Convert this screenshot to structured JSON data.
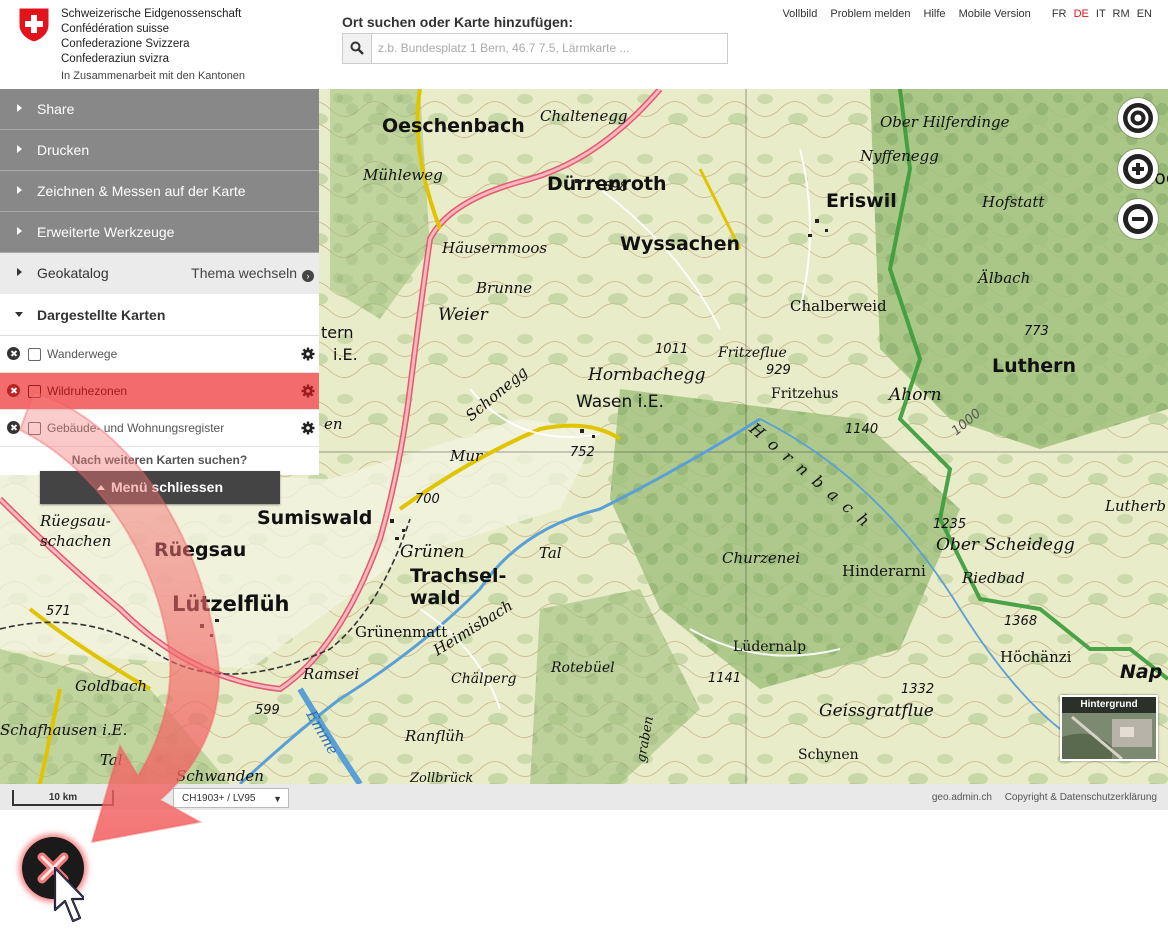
{
  "header": {
    "confederation_lines": [
      "Schweizerische Eidgenossenschaft",
      "Confédération suisse",
      "Confederazione Svizzera",
      "Confederaziun svizra"
    ],
    "cooperation": "In Zusammenarbeit mit den Kantonen",
    "search_title": "Ort suchen oder Karte hinzufügen:",
    "search_placeholder": "z.b. Bundesplatz 1 Bern, 46.7 7.5, Lärmkarte ...",
    "links": [
      "Vollbild",
      "Problem melden",
      "Hilfe",
      "Mobile Version"
    ],
    "languages": [
      "FR",
      "DE",
      "IT",
      "RM",
      "EN"
    ],
    "active_language": "DE",
    "accent_color": "#e3131b"
  },
  "menu": {
    "sections": [
      "Share",
      "Drucken",
      "Zeichnen & Messen auf der Karte",
      "Erweiterte Werkzeuge"
    ],
    "geokatalog": "Geokatalog",
    "thema_wechseln": "Thema wechseln",
    "dargestellte_karten": "Dargestellte Karten",
    "layers": [
      {
        "name": "Wanderwege",
        "highlighted": false
      },
      {
        "name": "Wildruhezonen",
        "highlighted": true
      },
      {
        "name": "Gebäude- und Wohnungsregister",
        "highlighted": false
      }
    ],
    "more_maps": "Nach weiteren Karten suchen?",
    "close_menu": "Menü schliessen",
    "highlight_color": "#f36c6c"
  },
  "map": {
    "labels": [
      {
        "text": "Oeschenbach",
        "cls": "big"
      },
      {
        "text": "Chaltenegg",
        "cls": "it"
      },
      {
        "text": "Mühleweg",
        "cls": "it"
      },
      {
        "text": "Dürrenroth",
        "cls": "big"
      },
      {
        "text": "698",
        "cls": "num"
      },
      {
        "text": "Wyssachen",
        "cls": "big"
      },
      {
        "text": "Häusernmoos",
        "cls": "it"
      },
      {
        "text": "Brunne",
        "cls": "it"
      },
      {
        "text": "Weier",
        "cls": "it"
      },
      {
        "text": "tern",
        "cls": "mid"
      },
      {
        "text": "i.E.",
        "cls": "mid"
      },
      {
        "text": "en",
        "cls": "it"
      },
      {
        "text": "1011",
        "cls": "num"
      },
      {
        "text": "Fritzeflue",
        "cls": "it"
      },
      {
        "text": "Hornbachegg",
        "cls": "it"
      },
      {
        "text": "929",
        "cls": "num"
      },
      {
        "text": "Fritzehus",
        "cls": "it"
      },
      {
        "text": "Wasen i.E.",
        "cls": "big"
      },
      {
        "text": "Schonegg",
        "cls": "it"
      },
      {
        "text": "Mur",
        "cls": "it"
      },
      {
        "text": "752",
        "cls": "num"
      },
      {
        "text": "700",
        "cls": "num"
      },
      {
        "text": "1140",
        "cls": "num"
      },
      {
        "text": "Ober Hilferdinge",
        "cls": "it"
      },
      {
        "text": "Nyffenegg",
        "cls": "it"
      },
      {
        "text": "Eriswil",
        "cls": "big"
      },
      {
        "text": "Hofstatt",
        "cls": "it"
      },
      {
        "text": "Älbach",
        "cls": "it"
      },
      {
        "text": "Chalberweid",
        "cls": "it"
      },
      {
        "text": "773",
        "cls": "num"
      },
      {
        "text": "Luthern",
        "cls": "big"
      },
      {
        "text": "Ahorn",
        "cls": "it"
      },
      {
        "text": "1000",
        "cls": "num"
      },
      {
        "text": "Hornbach",
        "cls": "it"
      },
      {
        "text": "Lutherb",
        "cls": "it"
      },
      {
        "text": "1235",
        "cls": "num"
      },
      {
        "text": "Ober Scheidegg",
        "cls": "it"
      },
      {
        "text": "Riedbad",
        "cls": "it"
      },
      {
        "text": "Hinderarni",
        "cls": "it"
      },
      {
        "text": "Churzenei",
        "cls": "it"
      },
      {
        "text": "1368",
        "cls": "num"
      },
      {
        "text": "Höchänzi",
        "cls": "it"
      },
      {
        "text": "Nap",
        "cls": "big"
      },
      {
        "text": "Rüegsau-",
        "cls": "it"
      },
      {
        "text": "schachen",
        "cls": "it"
      },
      {
        "text": "Rüegsau",
        "cls": "big"
      },
      {
        "text": "Sumiswald",
        "cls": "big"
      },
      {
        "text": "Grünen",
        "cls": "it"
      },
      {
        "text": "Trachsel-",
        "cls": "big"
      },
      {
        "text": "wald",
        "cls": "big"
      },
      {
        "text": "Tal",
        "cls": "it"
      },
      {
        "text": "571",
        "cls": "num"
      },
      {
        "text": "Lützelflüh",
        "cls": "big"
      },
      {
        "text": "Grünenmatt",
        "cls": "it"
      },
      {
        "text": "Heimisbach",
        "cls": "it"
      },
      {
        "text": "Lüdernalp",
        "cls": "it"
      },
      {
        "text": "Rotebüel",
        "cls": "it"
      },
      {
        "text": "Chälperg",
        "cls": "it"
      },
      {
        "text": "1141",
        "cls": "num"
      },
      {
        "text": "1332",
        "cls": "num"
      },
      {
        "text": "Geissgratflue",
        "cls": "it"
      },
      {
        "text": "Goldbach",
        "cls": "it"
      },
      {
        "text": "Ramsei",
        "cls": "it"
      },
      {
        "text": "599",
        "cls": "num"
      },
      {
        "text": "Schafhausen i.E.",
        "cls": "it"
      },
      {
        "text": "Ranflüh",
        "cls": "it"
      },
      {
        "text": "Emme",
        "cls": "it"
      },
      {
        "text": "Schwanden",
        "cls": "it"
      },
      {
        "text": "Schynen",
        "cls": "it"
      },
      {
        "text": "Tal",
        "cls": "it"
      },
      {
        "text": "Hoeg",
        "cls": "big"
      },
      {
        "text": "graben",
        "cls": "it"
      },
      {
        "text": "Zollbrück",
        "cls": "it"
      }
    ],
    "background_switch": "Hintergrund",
    "controls": [
      "locate-icon",
      "zoom-in-icon",
      "zoom-out-icon"
    ]
  },
  "footer": {
    "scale": "10 km",
    "crs": "CH1903+ / LV95",
    "site": "geo.admin.ch",
    "copyright": "Copyright & Datenschutzerklärung"
  }
}
